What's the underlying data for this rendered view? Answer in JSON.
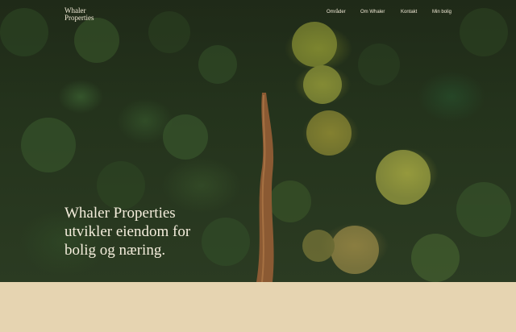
{
  "header": {
    "logo_line1": "Whaler",
    "logo_line2": "Properties",
    "nav": [
      {
        "label": "Områder"
      },
      {
        "label": "Om Whaler"
      },
      {
        "label": "Kontakt"
      },
      {
        "label": "Min bolig"
      }
    ]
  },
  "hero": {
    "headline_line1": "Whaler Properties",
    "headline_line2": "utvikler eiendom for",
    "headline_line3": "bolig og næring."
  },
  "colors": {
    "background_band": "#e6d4b1",
    "forest_dark": "#24331c",
    "text_light": "#f4eddc"
  }
}
